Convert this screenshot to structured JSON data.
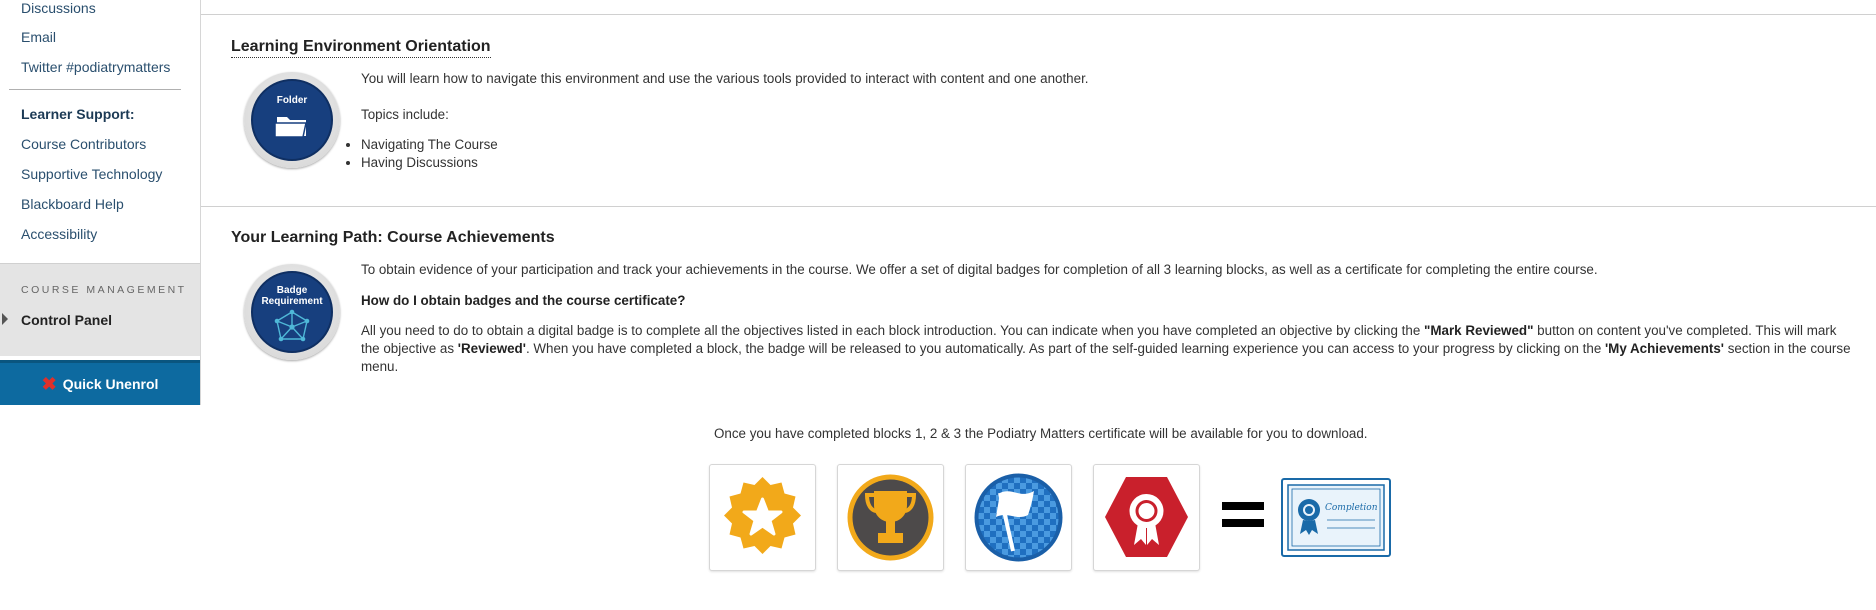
{
  "sidebar": {
    "links_top": [
      {
        "label": "Discussions"
      },
      {
        "label": "Email"
      },
      {
        "label": "Twitter #podiatrymatters"
      }
    ],
    "support_heading": "Learner Support:",
    "support_links": [
      {
        "label": "Course Contributors"
      },
      {
        "label": "Supportive Technology"
      },
      {
        "label": "Blackboard Help"
      },
      {
        "label": "Accessibility"
      }
    ],
    "management_title": "Course Management",
    "control_panel": "Control Panel",
    "unenrol_label": "Quick Unenrol"
  },
  "orientation": {
    "title": "Learning Environment Orientation",
    "badge_label": "Folder",
    "intro": "You will learn how to navigate this environment and use the various tools provided to interact with content and one another.",
    "topics_label": "Topics include:",
    "topics": [
      "Navigating The Course",
      "Having Discussions"
    ]
  },
  "achievements": {
    "title": "Your Learning Path: Course Achievements",
    "badge_label_1": "Badge",
    "badge_label_2": "Requirement",
    "intro": "To obtain evidence of your participation and track your achievements in the course. We offer a set of digital badges for completion of all 3 learning blocks, as well as a certificate for completing the entire course.",
    "question": "How do I obtain badges and the course certificate?",
    "body_1": "All you need to do to obtain a digital badge is to complete all the objectives listed in each block introduction.  You can indicate when you have completed an objective by clicking the ",
    "mark_reviewed": "\"Mark Reviewed\"",
    "body_2": " button on content you've completed. This will mark the objective as ",
    "reviewed": "'Reviewed'",
    "body_3": ". When you have completed a block, the badge will be released to you automatically.  As part of the self-guided learning experience you can access to your progress by clicking on the ",
    "my_achievements": "'My Achievements'",
    "body_4": " section in the course menu.",
    "certificate_note": "Once you have completed blocks 1, 2 & 3 the Podiatry Matters certificate will be available for you to download.",
    "certificate_label": "Completion",
    "badges": [
      {
        "icon": "star-badge-icon",
        "color": "#f2a91a"
      },
      {
        "icon": "trophy-badge-icon",
        "color": "#f2a91a"
      },
      {
        "icon": "flag-badge-icon",
        "color": "#1f6fc0"
      },
      {
        "icon": "rosette-badge-icon",
        "color": "#c9202c"
      }
    ]
  }
}
